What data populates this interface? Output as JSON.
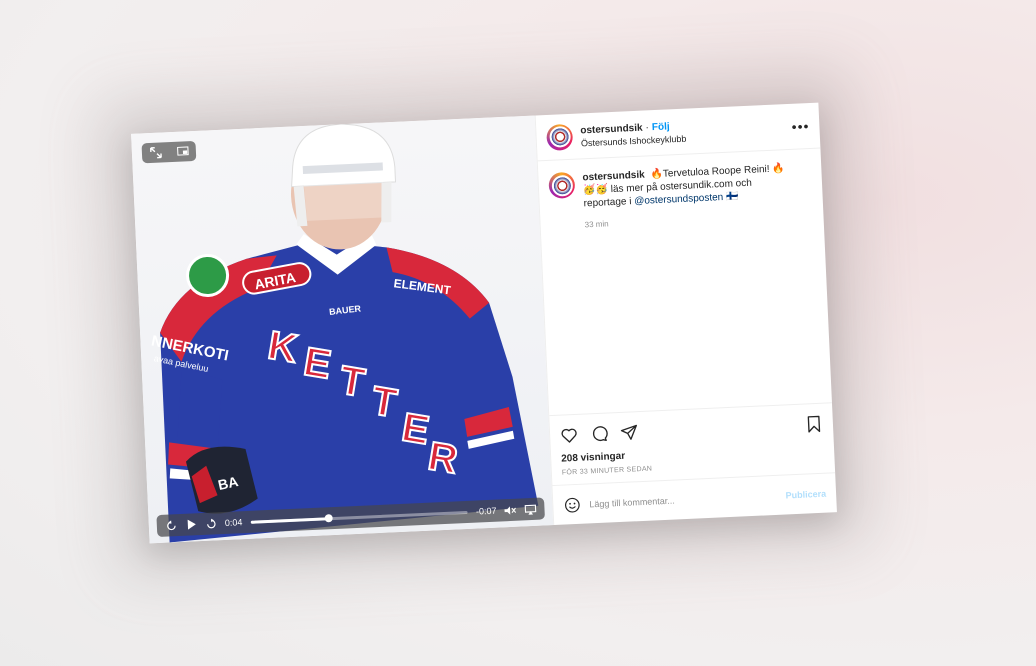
{
  "post": {
    "username": "ostersundsik",
    "follow_label": "Följ",
    "subtitle": "Östersunds Ishockeyklubb",
    "more_label": "•••",
    "caption": {
      "username": "ostersundsik",
      "text": "🔥Tervetuloa Roope Reini! 🔥🥳🥳 läs mer på ostersundik.com och reportage i",
      "mention": "@ostersundsposten",
      "flag": "🇫🇮"
    },
    "caption_time": "33 min",
    "views": "208 visningar",
    "time_ago": "FÖR 33 MINUTER SEDAN",
    "comment_placeholder": "Lägg till kommentar...",
    "publish_label": "Publicera"
  },
  "video": {
    "elapsed": "0:04",
    "remaining": "-0:07",
    "progress": 0.36,
    "jersey": {
      "chest_text": "KETTERÄ",
      "sponsor_left": "NNERKOTI",
      "sponsor_left_sub": "avaa palveluu",
      "sponsor_patch": "ARITA",
      "sponsor_right": "ELEMENT",
      "brand": "BAUER",
      "glove": "BA"
    }
  },
  "icons": {
    "expand": "expand-icon",
    "pip": "pip-icon",
    "rewind": "rewind-icon",
    "play": "play-icon",
    "forward": "forward-icon",
    "mute": "mute-icon",
    "airplay": "airplay-icon",
    "like": "heart-icon",
    "comment": "comment-icon",
    "share": "send-icon",
    "save": "bookmark-icon",
    "emoji": "emoji-icon"
  },
  "colors": {
    "link": "#0095f6",
    "jersey_blue": "#2a3fa8",
    "jersey_red": "#d8283b"
  }
}
